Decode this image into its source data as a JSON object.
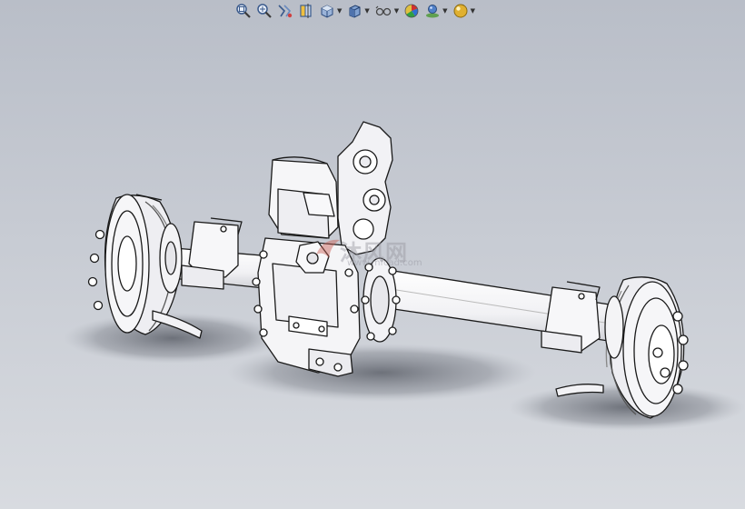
{
  "viewport": {
    "background_top": "#b9bec8",
    "background_bottom": "#d8dbe0"
  },
  "toolbar": {
    "items": [
      {
        "icon": "zoom-to-fit-icon",
        "has_dropdown": false
      },
      {
        "icon": "zoom-to-area-icon",
        "has_dropdown": false
      },
      {
        "icon": "previous-view-icon",
        "has_dropdown": false
      },
      {
        "icon": "section-view-icon",
        "has_dropdown": false
      },
      {
        "icon": "view-orientation-icon",
        "has_dropdown": true
      },
      {
        "icon": "display-style-icon",
        "has_dropdown": true
      },
      {
        "icon": "hide-show-items-icon",
        "has_dropdown": true
      },
      {
        "icon": "edit-appearance-icon",
        "has_dropdown": false
      },
      {
        "icon": "apply-scene-icon",
        "has_dropdown": true
      },
      {
        "icon": "view-settings-icon",
        "has_dropdown": true
      }
    ]
  },
  "watermark": {
    "main_text": "沐风网",
    "sub_text": "www.mfcad.com"
  },
  "model": {
    "subject": "rear-axle-assembly",
    "part_color": "#f4f4f6",
    "edge_color": "#1a1a1a",
    "shadow_color": "#6f737c"
  }
}
